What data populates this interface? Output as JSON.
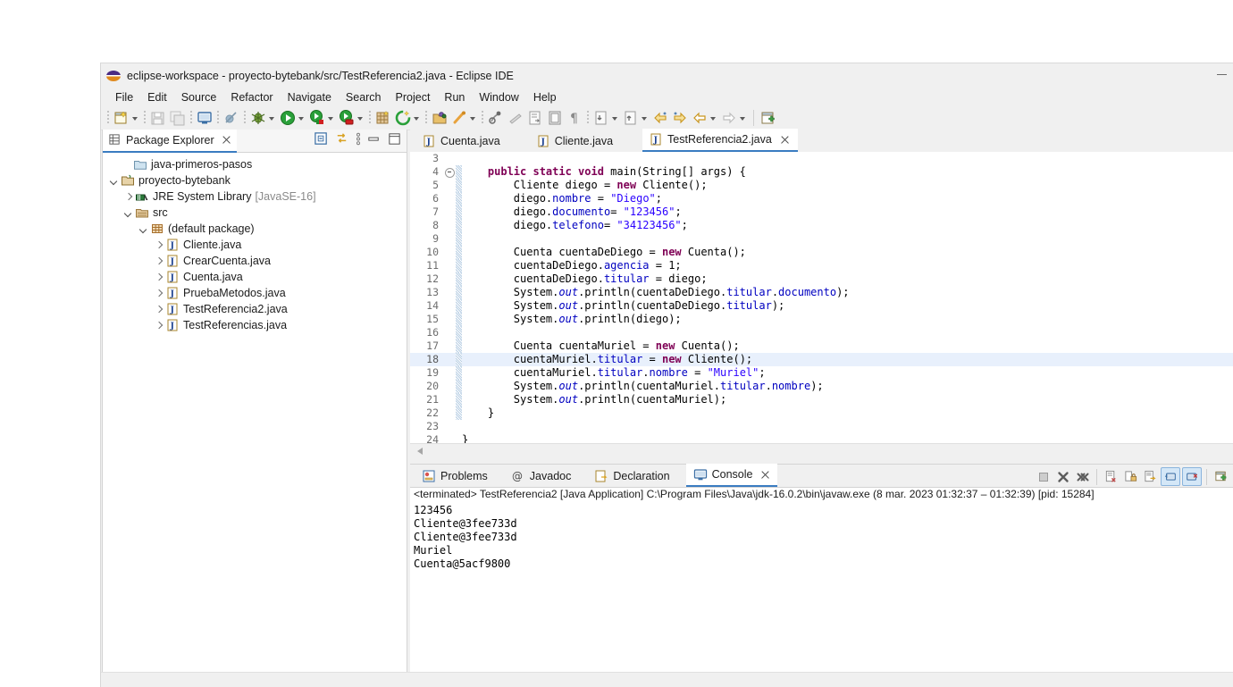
{
  "window": {
    "title": "eclipse-workspace - proyecto-bytebank/src/TestReferencia2.java - Eclipse IDE",
    "app_icon": "eclipse-icon",
    "minimize_label": "Minimize"
  },
  "menubar": {
    "items": [
      "File",
      "Edit",
      "Source",
      "Refactor",
      "Navigate",
      "Search",
      "Project",
      "Run",
      "Window",
      "Help"
    ]
  },
  "toolbar": {
    "groups": [
      [
        "new-wizard-icon",
        "new-dropdown-arrow"
      ],
      [
        "save-icon",
        "save-all-icon"
      ],
      [
        "open-console-icon"
      ],
      [
        "toggle-breakpoint-icon"
      ],
      [
        "debug-icon",
        "debug-dropdown-arrow"
      ],
      [
        "run-icon",
        "run-dropdown-arrow"
      ],
      [
        "run-coverage-icon",
        "coverage-dropdown-arrow"
      ],
      [
        "profile-icon",
        "profile-dropdown-arrow"
      ],
      [
        "new-java-package-icon"
      ],
      [
        "external-tools-icon",
        "external-tools-dropdown-arrow"
      ],
      [
        "open-type-icon",
        "search-icon",
        "search-dropdown-arrow"
      ],
      [
        "last-edit-location-icon",
        "skip-all-breakpoints-icon",
        "toggle-mark-occurrences-icon",
        "block-selection-icon",
        "show-whitespace-icon"
      ],
      [
        "next-annotation-icon",
        "next-annotation-arrow",
        "previous-annotation-icon",
        "previous-annotation-arrow"
      ],
      [
        "back-icon",
        "back-dropdown-arrow",
        "forward-icon",
        "forward-dropdown-arrow"
      ],
      [
        "new-window-icon"
      ]
    ]
  },
  "package_explorer": {
    "tab_label": "Package Explorer",
    "tab_icon": "package-explorer-icon",
    "view_tools": [
      "collapse-all-icon",
      "link-with-editor-icon",
      "view-menu-icon",
      "minimize-icon",
      "maximize-icon"
    ],
    "tree": [
      {
        "label": "java-primeros-pasos",
        "icon": "folder-closed-icon",
        "indent": 1,
        "twisty": "none"
      },
      {
        "label": "proyecto-bytebank",
        "icon": "java-project-icon",
        "indent": 0,
        "twisty": "down"
      },
      {
        "label": "JRE System Library",
        "suffix": "[JavaSE-16]",
        "icon": "jre-library-icon",
        "indent": 1,
        "twisty": "right"
      },
      {
        "label": "src",
        "icon": "source-folder-icon",
        "indent": 1,
        "twisty": "down"
      },
      {
        "label": "(default package)",
        "icon": "package-icon",
        "indent": 2,
        "twisty": "down"
      },
      {
        "label": "Cliente.java",
        "icon": "java-file-icon",
        "indent": 3,
        "twisty": "right"
      },
      {
        "label": "CrearCuenta.java",
        "icon": "java-file-icon",
        "indent": 3,
        "twisty": "right"
      },
      {
        "label": "Cuenta.java",
        "icon": "java-file-icon",
        "indent": 3,
        "twisty": "right"
      },
      {
        "label": "PruebaMetodos.java",
        "icon": "java-file-icon",
        "indent": 3,
        "twisty": "right"
      },
      {
        "label": "TestReferencia2.java",
        "icon": "java-file-icon",
        "indent": 3,
        "twisty": "right"
      },
      {
        "label": "TestReferencias.java",
        "icon": "java-file-icon",
        "indent": 3,
        "twisty": "right"
      }
    ]
  },
  "editor": {
    "tabs": [
      {
        "label": "Cuenta.java",
        "icon": "java-file-icon",
        "active": false,
        "closable": false
      },
      {
        "label": "Cliente.java",
        "icon": "java-file-icon",
        "active": false,
        "closable": false
      },
      {
        "label": "TestReferencia2.java",
        "icon": "java-file-icon",
        "active": true,
        "closable": true
      }
    ],
    "lines": [
      {
        "n": "3",
        "html": "",
        "fold": false,
        "hl": false,
        "change": false
      },
      {
        "n": "4",
        "html": "    <span class='kw'>public static void</span> main(String[] args) {",
        "fold": true,
        "hl": false,
        "change": true
      },
      {
        "n": "5",
        "html": "        Cliente diego = <span class='kw'>new</span> Cliente();",
        "fold": false,
        "hl": false,
        "change": true
      },
      {
        "n": "6",
        "html": "        diego.<span class='fld'>nombre</span> = <span class='str'>\"Diego\"</span>;",
        "fold": false,
        "hl": false,
        "change": true
      },
      {
        "n": "7",
        "html": "        diego.<span class='fld'>documento</span>= <span class='str'>\"123456\"</span>;",
        "fold": false,
        "hl": false,
        "change": true
      },
      {
        "n": "8",
        "html": "        diego.<span class='fld'>telefono</span>= <span class='str'>\"34123456\"</span>;",
        "fold": false,
        "hl": false,
        "change": true
      },
      {
        "n": "9",
        "html": "",
        "fold": false,
        "hl": false,
        "change": true
      },
      {
        "n": "10",
        "html": "        Cuenta cuentaDeDiego = <span class='kw'>new</span> Cuenta();",
        "fold": false,
        "hl": false,
        "change": true
      },
      {
        "n": "11",
        "html": "        cuentaDeDiego.<span class='fld'>agencia</span> = 1;",
        "fold": false,
        "hl": false,
        "change": true
      },
      {
        "n": "12",
        "html": "        cuentaDeDiego.<span class='fld'>titular</span> = diego;",
        "fold": false,
        "hl": false,
        "change": true
      },
      {
        "n": "13",
        "html": "        System.<span class='stat'>out</span>.println(cuentaDeDiego.<span class='fld'>titular</span>.<span class='fld'>documento</span>);",
        "fold": false,
        "hl": false,
        "change": true
      },
      {
        "n": "14",
        "html": "        System.<span class='stat'>out</span>.println(cuentaDeDiego.<span class='fld'>titular</span>);",
        "fold": false,
        "hl": false,
        "change": true
      },
      {
        "n": "15",
        "html": "        System.<span class='stat'>out</span>.println(diego);",
        "fold": false,
        "hl": false,
        "change": true
      },
      {
        "n": "16",
        "html": "",
        "fold": false,
        "hl": false,
        "change": true
      },
      {
        "n": "17",
        "html": "        Cuenta cuentaMuriel = <span class='kw'>new</span> Cuenta();",
        "fold": false,
        "hl": false,
        "change": true
      },
      {
        "n": "18",
        "html": "        cuentaMuriel.<span class='fld'>titular</span> = <span class='kw'>new</span> Cliente();",
        "fold": false,
        "hl": true,
        "change": true
      },
      {
        "n": "19",
        "html": "        cuentaMuriel.<span class='fld'>titular</span>.<span class='fld'>nombre</span> = <span class='str'>\"Muriel\"</span>;",
        "fold": false,
        "hl": false,
        "change": true
      },
      {
        "n": "20",
        "html": "        System.<span class='stat'>out</span>.println(cuentaMuriel.<span class='fld'>titular</span>.<span class='fld'>nombre</span>);",
        "fold": false,
        "hl": false,
        "change": true
      },
      {
        "n": "21",
        "html": "        System.<span class='stat'>out</span>.println(cuentaMuriel);",
        "fold": false,
        "hl": false,
        "change": true
      },
      {
        "n": "22",
        "html": "    }",
        "fold": false,
        "hl": false,
        "change": true
      },
      {
        "n": "23",
        "html": "",
        "fold": false,
        "hl": false,
        "change": false
      },
      {
        "n": "24",
        "html": "}",
        "fold": false,
        "hl": false,
        "change": false
      }
    ]
  },
  "bottom_panel": {
    "tabs": [
      {
        "label": "Problems",
        "icon": "problems-icon",
        "active": false,
        "closable": false
      },
      {
        "label": "Javadoc",
        "icon": "javadoc-icon",
        "active": false,
        "closable": false
      },
      {
        "label": "Declaration",
        "icon": "declaration-icon",
        "active": false,
        "closable": false
      },
      {
        "label": "Console",
        "icon": "console-icon",
        "active": true,
        "closable": true
      }
    ],
    "tools": [
      {
        "name": "terminate-icon",
        "active": false
      },
      {
        "name": "remove-launch-icon",
        "active": false
      },
      {
        "name": "remove-all-terminated-icon",
        "active": false
      },
      {
        "name": "clear-console-icon",
        "active": false
      },
      {
        "name": "scroll-lock-icon",
        "active": false
      },
      {
        "name": "word-wrap-icon",
        "active": false
      },
      {
        "name": "show-console-on-output-icon",
        "active": true
      },
      {
        "name": "show-console-on-error-icon",
        "active": true
      },
      {
        "name": "pin-console-icon",
        "active": false
      },
      {
        "name": "display-selected-console-icon",
        "active": false
      }
    ],
    "console": {
      "header": "<terminated> TestReferencia2 [Java Application] C:\\Program Files\\Java\\jdk-16.0.2\\bin\\javaw.exe  (8 mar. 2023 01:32:37 – 01:32:39) [pid: 15284]",
      "output": [
        {
          "text": "123456",
          "selected": false
        },
        {
          "text": "Cliente@3fee733d",
          "selected": false
        },
        {
          "text": "Cliente@3fee733d",
          "selected": true
        },
        {
          "text": "Muriel",
          "selected": false
        },
        {
          "text": "Cuenta@5acf9800",
          "selected": false
        }
      ]
    }
  },
  "colors": {
    "accent": "#3a7cc1",
    "selection": "#1f74d0",
    "keyword": "#7f0055",
    "string": "#2a00ff",
    "field": "#0000c0",
    "line_highlight": "#e8f0fc",
    "chrome": "#f0f0f0"
  }
}
